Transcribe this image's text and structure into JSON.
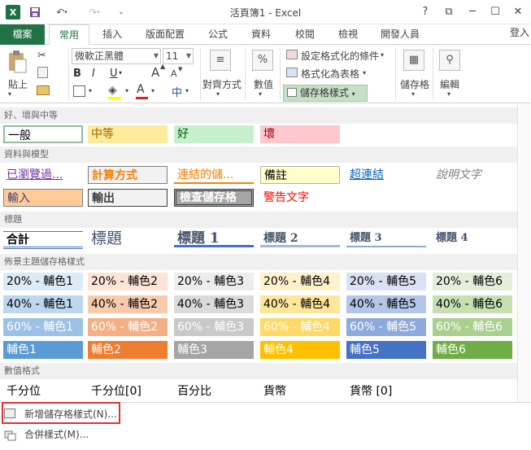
{
  "window": {
    "title": "活頁簿1 - Excel",
    "help": "?",
    "controls": [
      "⧉",
      "─",
      "☐",
      "✕"
    ]
  },
  "tabs": {
    "file": "檔案",
    "items": [
      "常用",
      "插入",
      "版面配置",
      "公式",
      "資料",
      "校閱",
      "檢視",
      "開發人員"
    ],
    "active": "常用",
    "login": "登入"
  },
  "ribbon": {
    "paste": "貼上",
    "font_name": "微軟正黑體",
    "font_size": "11",
    "alignment": "對齊方式",
    "number": "數值",
    "conditional_format": "設定格式化的條件",
    "format_as_table": "格式化為表格",
    "cell_styles": "儲存格樣式",
    "cells": "儲存格",
    "editing": "編輯",
    "number_symbol": "%",
    "bold": "B",
    "italic": "I",
    "underline": "U",
    "font_color_letter": "A",
    "phonetic": "中",
    "grow_font": "A",
    "shrink_font": "A"
  },
  "gallery": {
    "sections": {
      "good_bad": "好、壞與中等",
      "data_model": "資料與模型",
      "titles": "標題",
      "themed": "佈景主題儲存格樣式",
      "number_format": "數值格式"
    },
    "good_bad": [
      "一般",
      "中等",
      "好",
      "壞"
    ],
    "data_model_row1": [
      "已瀏覽過...",
      "計算方式",
      "連結的儲...",
      "備註",
      "超連結",
      "說明文字"
    ],
    "data_model_row2": [
      "輸入",
      "輸出",
      "檢查儲存格",
      "警告文字"
    ],
    "titles": [
      "合計",
      "標題",
      "標題 1",
      "標題 2",
      "標題 3",
      "標題 4"
    ],
    "themed_20": [
      "20% - 輔色1",
      "20% - 輔色2",
      "20% - 輔色3",
      "20% - 輔色4",
      "20% - 輔色5",
      "20% - 輔色6"
    ],
    "themed_40": [
      "40% - 輔色1",
      "40% - 輔色2",
      "40% - 輔色3",
      "40% - 輔色4",
      "40% - 輔色5",
      "40% - 輔色6"
    ],
    "themed_60": [
      "60% - 輔色1",
      "60% - 輔色2",
      "60% - 輔色3",
      "60% - 輔色4",
      "60% - 輔色5",
      "60% - 輔色6"
    ],
    "themed_100": [
      "輔色1",
      "輔色2",
      "輔色3",
      "輔色4",
      "輔色5",
      "輔色6"
    ],
    "number_styles": [
      "千分位",
      "千分位[0]",
      "百分比",
      "貨幣",
      "貨幣 [0]"
    ]
  },
  "menu": {
    "new_style": "新增儲存格樣式(N)...",
    "merge_styles": "合併樣式(M)..."
  },
  "colors": {
    "excel_green": "#217346",
    "highlight": "#c6e0c8",
    "red_box": "#e03030"
  }
}
